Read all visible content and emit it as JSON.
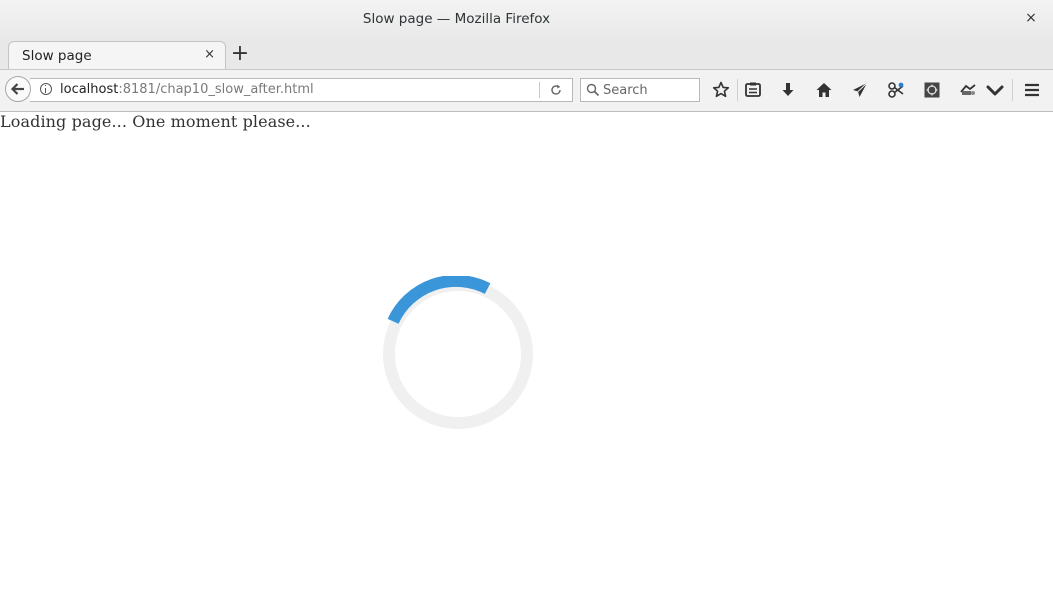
{
  "window": {
    "title": "Slow page — Mozilla Firefox",
    "close_glyph": "×"
  },
  "tabs": [
    {
      "label": "Slow page",
      "close_glyph": "×",
      "active": true
    }
  ],
  "new_tab_glyph": "+",
  "urlbar": {
    "host": "localhost",
    "path": ":8181/chap10_slow_after.html"
  },
  "search": {
    "placeholder": "Search"
  },
  "toolbar_icons": [
    "bookmark-star-icon",
    "reading-list-icon",
    "download-icon",
    "home-icon",
    "send-icon",
    "extension-icon",
    "screenshot-icon",
    "extension-2-icon",
    "pocket-icon",
    "hamburger-menu-icon"
  ],
  "page": {
    "loading_text": "Loading page... One moment please..."
  },
  "colors": {
    "spinner_accent": "#3b95d9",
    "spinner_track": "#f0f0f0"
  }
}
